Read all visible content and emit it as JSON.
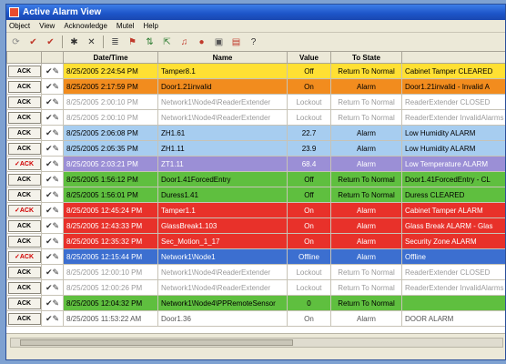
{
  "window": {
    "title": "Active Alarm View"
  },
  "menu": [
    "Object",
    "View",
    "Acknowledge",
    "Mutel",
    "Help"
  ],
  "toolbar": [
    {
      "icon": "refresh-icon",
      "glyph": "⟳",
      "color": "#888"
    },
    {
      "icon": "ack-icon",
      "glyph": "✔",
      "color": "#c0392b"
    },
    {
      "icon": "ack-all-icon",
      "glyph": "✔",
      "color": "#c0392b"
    },
    {
      "icon": "sep",
      "glyph": ""
    },
    {
      "icon": "settings-icon",
      "glyph": "✱",
      "color": "#333"
    },
    {
      "icon": "delete-icon",
      "glyph": "✕",
      "color": "#333"
    },
    {
      "icon": "sep",
      "glyph": ""
    },
    {
      "icon": "list-icon",
      "glyph": "≣",
      "color": "#555"
    },
    {
      "icon": "filter-icon",
      "glyph": "⚑",
      "color": "#c0392b"
    },
    {
      "icon": "sort-icon",
      "glyph": "⇅",
      "color": "#2e7d32"
    },
    {
      "icon": "export-icon",
      "glyph": "⇱",
      "color": "#2e7d32"
    },
    {
      "icon": "bell-icon",
      "glyph": "♫",
      "color": "#c0392b"
    },
    {
      "icon": "alarm-icon",
      "glyph": "●",
      "color": "#c0392b"
    },
    {
      "icon": "monitor-icon",
      "glyph": "▣",
      "color": "#555"
    },
    {
      "icon": "report-icon",
      "glyph": "▤",
      "color": "#c0392b"
    },
    {
      "icon": "help-icon",
      "glyph": "?",
      "color": "#333"
    }
  ],
  "columns": [
    "",
    "",
    "Date/Time",
    "Name",
    "Value",
    "To State",
    ""
  ],
  "rows": [
    {
      "ack": "ACK",
      "ackRed": false,
      "bg": "#ffe033",
      "fg": "#000",
      "date": "8/25/2005 2:24:54 PM",
      "name": "Tamper8.1",
      "value": "Off",
      "state": "Return To Normal",
      "desc": "Cabinet Tamper CLEARED"
    },
    {
      "ack": "ACK",
      "ackRed": false,
      "bg": "#f28c1e",
      "fg": "#000",
      "date": "8/25/2005 2:17:59 PM",
      "name": "Door1.21invalid",
      "value": "On",
      "state": "Alarm",
      "desc": "Door1.21invalid - Invalid A"
    },
    {
      "ack": "ACK",
      "ackRed": false,
      "bg": "#ffffff",
      "fg": "#9a9a9a",
      "date": "8/25/2005 2:00:10 PM",
      "name": "Network1\\Node4\\ReaderExtender",
      "value": "Lockout",
      "state": "Return To Normal",
      "desc": "ReaderExtender CLOSED"
    },
    {
      "ack": "ACK",
      "ackRed": false,
      "bg": "#ffffff",
      "fg": "#9a9a9a",
      "date": "8/25/2005 2:00:10 PM",
      "name": "Network1\\Node4\\ReaderExtender",
      "value": "Lockout",
      "state": "Return To Normal",
      "desc": "ReaderExtender InvalidAlarms"
    },
    {
      "ack": "ACK",
      "ackRed": false,
      "bg": "#a7cdf0",
      "fg": "#000",
      "date": "8/25/2005 2:06:08 PM",
      "name": "ZH1.61",
      "value": "22.7",
      "state": "Alarm",
      "desc": "Low Humidity ALARM"
    },
    {
      "ack": "ACK",
      "ackRed": false,
      "bg": "#a7cdf0",
      "fg": "#000",
      "date": "8/25/2005 2:05:35 PM",
      "name": "ZH1.11",
      "value": "23.9",
      "state": "Alarm",
      "desc": "Low Humidity ALARM"
    },
    {
      "ack": "✓ACK",
      "ackRed": true,
      "bg": "#9b8fd6",
      "fg": "#ffffff",
      "date": "8/25/2005 2:03:21 PM",
      "name": "ZT1.11",
      "value": "68.4",
      "state": "Alarm",
      "desc": "Low Temperature ALARM"
    },
    {
      "ack": "ACK",
      "ackRed": false,
      "bg": "#5fbf3f",
      "fg": "#000",
      "date": "8/25/2005 1:56:12 PM",
      "name": "Door1.41ForcedEntry",
      "value": "Off",
      "state": "Return To Normal",
      "desc": "Door1.41ForcedEntry - CL"
    },
    {
      "ack": "ACK",
      "ackRed": false,
      "bg": "#5fbf3f",
      "fg": "#000",
      "date": "8/25/2005 1:56:01 PM",
      "name": "Duress1.41",
      "value": "Off",
      "state": "Return To Normal",
      "desc": "Duress CLEARED"
    },
    {
      "ack": "✓ACK",
      "ackRed": true,
      "bg": "#e8312a",
      "fg": "#ffffff",
      "date": "8/25/2005 12:45:24 PM",
      "name": "Tamper1.1",
      "value": "On",
      "state": "Alarm",
      "desc": "Cabinet Tamper ALARM"
    },
    {
      "ack": "ACK",
      "ackRed": false,
      "bg": "#e8312a",
      "fg": "#ffffff",
      "date": "8/25/2005 12:43:33 PM",
      "name": "GlassBreak1.103",
      "value": "On",
      "state": "Alarm",
      "desc": "Glass Break ALARM - Glas"
    },
    {
      "ack": "ACK",
      "ackRed": false,
      "bg": "#e8312a",
      "fg": "#ffffff",
      "date": "8/25/2005 12:35:32 PM",
      "name": "Sec_Motion_1_17",
      "value": "On",
      "state": "Alarm",
      "desc": "Security Zone ALARM"
    },
    {
      "ack": "✓ACK",
      "ackRed": true,
      "bg": "#3c6fd0",
      "fg": "#ffffff",
      "date": "8/25/2005 12:15:44 PM",
      "name": "Network1\\Node1",
      "value": "Offline",
      "state": "Alarm",
      "desc": "Offline"
    },
    {
      "ack": "ACK",
      "ackRed": false,
      "bg": "#ffffff",
      "fg": "#9a9a9a",
      "date": "8/25/2005 12:00:10 PM",
      "name": "Network1\\Node4\\ReaderExtender",
      "value": "Lockout",
      "state": "Return To Normal",
      "desc": "ReaderExtender CLOSED"
    },
    {
      "ack": "ACK",
      "ackRed": false,
      "bg": "#ffffff",
      "fg": "#9a9a9a",
      "date": "8/25/2005 12:00:26 PM",
      "name": "Network1\\Node4\\ReaderExtender",
      "value": "Lockout",
      "state": "Return To Normal",
      "desc": "ReaderExtender InvalidAlarms"
    },
    {
      "ack": "ACK",
      "ackRed": false,
      "bg": "#5fbf3f",
      "fg": "#000",
      "date": "8/25/2005 12:04:32 PM",
      "name": "Network1\\Node4\\PPRemoteSensor",
      "value": "0",
      "state": "Return To Normal",
      "desc": ""
    },
    {
      "ack": "ACK",
      "ackRed": false,
      "bg": "#ffffff",
      "fg": "#555",
      "date": "8/25/2005 11:53:22 AM",
      "name": "Door1.36",
      "value": "On",
      "state": "Alarm",
      "desc": "DOOR ALARM"
    }
  ]
}
